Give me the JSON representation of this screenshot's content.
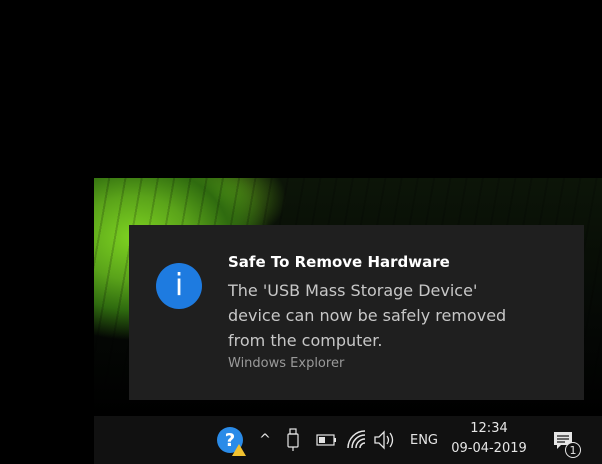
{
  "notification": {
    "title": "Safe To Remove Hardware",
    "body_lines": [
      "The 'USB Mass Storage Device'",
      "device can now be safely removed",
      "from the computer."
    ],
    "source": "Windows Explorer",
    "icon": "info-icon",
    "icon_glyph": "i",
    "accent_color": "#1e7be0"
  },
  "taskbar": {
    "icons": [
      "help-icon",
      "chevron-up-icon",
      "usb-icon",
      "battery-icon",
      "wifi-icon",
      "volume-icon",
      "action-center-icon"
    ],
    "help_glyph": "?",
    "chevron_glyph": "^",
    "language": "ENG",
    "time": "12:34",
    "date": "09-04-2019",
    "notification_count": "1"
  }
}
